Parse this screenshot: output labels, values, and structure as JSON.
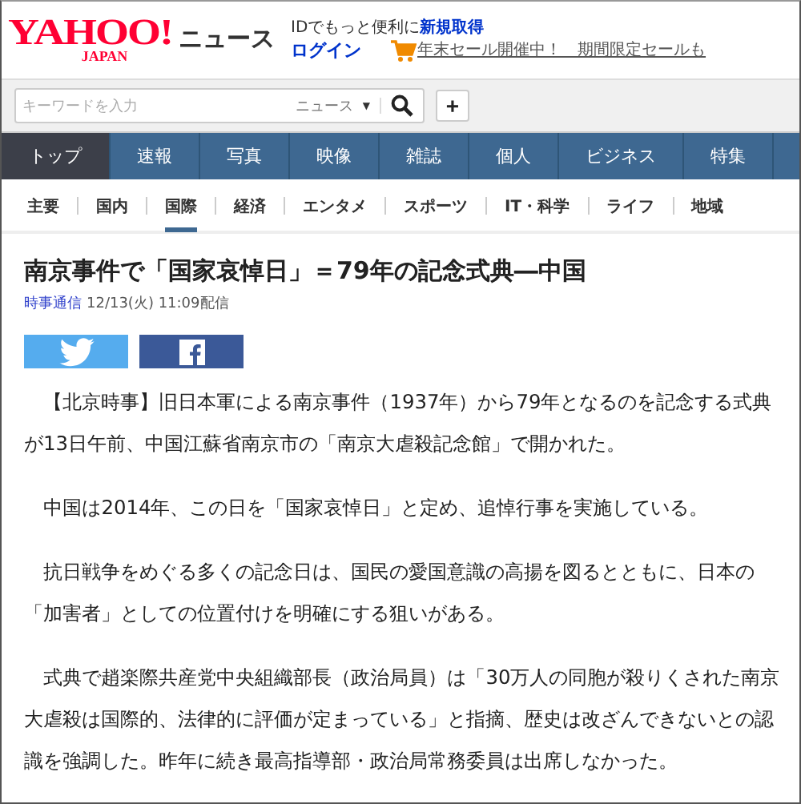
{
  "header": {
    "logo": {
      "main": "YAHOO!",
      "sub": "JAPAN"
    },
    "section": "ニュース",
    "account_prompt": {
      "text": "IDでもっと便利に",
      "link": "新規取得"
    },
    "login": "ログイン",
    "promo": "年末セール開催中！　期間限定セールも"
  },
  "search": {
    "placeholder": "キーワードを入力",
    "scope": "ニュース",
    "scope_caret": "▼",
    "add_button": "+"
  },
  "main_nav": [
    {
      "label": "トップ",
      "selected": true
    },
    {
      "label": "速報",
      "selected": false
    },
    {
      "label": "写真",
      "selected": false
    },
    {
      "label": "映像",
      "selected": false
    },
    {
      "label": "雑誌",
      "selected": false
    },
    {
      "label": "個人",
      "selected": false
    },
    {
      "label": "ビジネス",
      "selected": false
    },
    {
      "label": "特集",
      "selected": false
    }
  ],
  "category_nav": [
    {
      "label": "主要",
      "selected": false
    },
    {
      "label": "国内",
      "selected": false
    },
    {
      "label": "国際",
      "selected": true
    },
    {
      "label": "経済",
      "selected": false
    },
    {
      "label": "エンタメ",
      "selected": false
    },
    {
      "label": "スポーツ",
      "selected": false
    },
    {
      "label": "IT・科学",
      "selected": false
    },
    {
      "label": "ライフ",
      "selected": false
    },
    {
      "label": "地域",
      "selected": false
    }
  ],
  "article": {
    "title": "南京事件で「国家哀悼日」＝79年の記念式典―中国",
    "source": "時事通信",
    "date": "12/13(火) 11:09配信",
    "share_buttons": [
      {
        "kind": "twitter"
      },
      {
        "kind": "facebook"
      }
    ],
    "paragraphs": [
      "【北京時事】旧日本軍による南京事件（1937年）から79年となるのを記念する式典が13日午前、中国江蘇省南京市の「南京大虐殺記念館」で開かれた。",
      "中国は2014年、この日を「国家哀悼日」と定め、追悼行事を実施している。",
      "抗日戦争をめぐる多くの記念日は、国民の愛国意識の高揚を図るとともに、日本の「加害者」としての位置付けを明確にする狙いがある。",
      "式典で趙楽際共産党中央組織部長（政治局員）は「30万人の同胞が殺りくされた南京大虐殺は国際的、法律的に評価が定まっている」と指摘、歴史は改ざんできないとの認識を強調した。昨年に続き最高指導部・政治局常務委員は出席しなかった。"
    ]
  }
}
